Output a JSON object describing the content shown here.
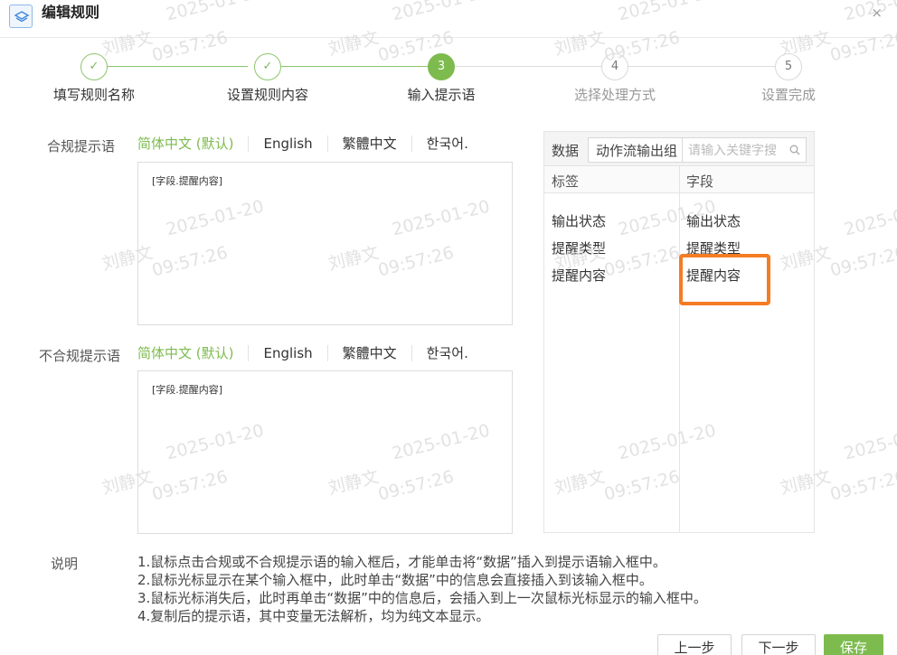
{
  "window": {
    "title": "编辑规则",
    "close_glyph": "×"
  },
  "steps": [
    {
      "marker": "✓",
      "label": "填写规则名称",
      "state": "done"
    },
    {
      "marker": "✓",
      "label": "设置规则内容",
      "state": "done"
    },
    {
      "marker": "3",
      "label": "输入提示语",
      "state": "active"
    },
    {
      "marker": "4",
      "label": "选择处理方式",
      "state": "todo"
    },
    {
      "marker": "5",
      "label": "设置完成",
      "state": "todo"
    }
  ],
  "compliant": {
    "label": "合规提示语",
    "tabs": [
      "简体中文 (默认)",
      "English",
      "繁體中文",
      "한국어."
    ],
    "value": "[字段.提醒内容]"
  },
  "noncompliant": {
    "label": "不合规提示语",
    "tabs": [
      "简体中文 (默认)",
      "English",
      "繁體中文",
      "한국어."
    ],
    "value": "[字段.提醒内容]"
  },
  "data_panel": {
    "label": "数据",
    "source": "动作流输出组",
    "search_placeholder": "请输入关键字搜",
    "headers": {
      "tag": "标签",
      "field": "字段"
    },
    "rows": [
      {
        "tag": "输出状态",
        "field": "输出状态"
      },
      {
        "tag": "提醒类型",
        "field": "提醒类型"
      },
      {
        "tag": "提醒内容",
        "field": "提醒内容"
      }
    ]
  },
  "notes": {
    "title": "说明",
    "lines": [
      "1.鼠标点击合规或不合规提示语的输入框后，才能单击将“数据”插入到提示语输入框中。",
      "2.鼠标光标显示在某个输入框中，此时单击“数据”中的信息会直接插入到该输入框中。",
      "3.鼠标光标消失后，此时再单击“数据”中的信息后，会插入到上一次鼠标光标显示的输入框中。",
      "4.复制后的提示语，其中变量无法解析，均为纯文本显示。"
    ]
  },
  "buttons": {
    "prev": "上一步",
    "next": "下一步",
    "save": "保存"
  },
  "watermark": {
    "name": "刘静文",
    "date": "2025-01-20",
    "time": "09:57:26"
  },
  "colors": {
    "accent": "#7dbb4e",
    "highlight": "#f57c24"
  }
}
